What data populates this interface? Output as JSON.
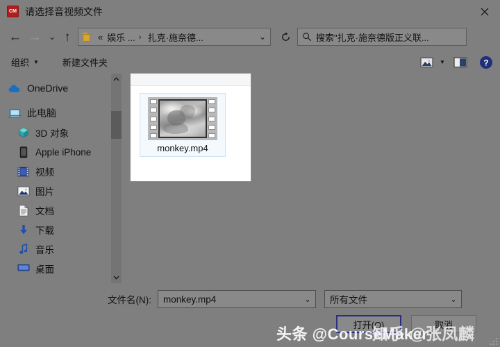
{
  "window": {
    "app_icon_text": "CM",
    "title": "请选择音视频文件",
    "close_label": "✕"
  },
  "nav": {
    "back_label": "←",
    "forward_label": "→",
    "recent_label": "⌄",
    "up_label": "↑",
    "refresh_label": "↻",
    "breadcrumb": {
      "prefix": "«",
      "parent": "娱乐 ...",
      "separator": "›",
      "current": "扎克·施奈德...",
      "chevron": "⌄"
    }
  },
  "search": {
    "icon": "search-icon",
    "placeholder": "搜索\"扎克·施奈德版正义联..."
  },
  "commandbar": {
    "organize_label": "组织",
    "organize_caret": "▼",
    "new_folder_label": "新建文件夹",
    "view_icon": "picture-view-icon",
    "view_caret": "▼",
    "preview_pane_icon": "preview-pane-icon",
    "help_icon": "help-icon",
    "help_glyph": "?"
  },
  "sidebar": {
    "items": [
      {
        "label": "OneDrive",
        "icon": "cloud-icon",
        "level": "root"
      },
      {
        "label": "此电脑",
        "icon": "this-pc-icon",
        "level": "root"
      },
      {
        "label": "3D 对象",
        "icon": "3d-objects-icon",
        "level": "child"
      },
      {
        "label": "Apple iPhone",
        "icon": "iphone-icon",
        "level": "child"
      },
      {
        "label": "视频",
        "icon": "videos-icon",
        "level": "child"
      },
      {
        "label": "图片",
        "icon": "pictures-icon",
        "level": "child"
      },
      {
        "label": "文档",
        "icon": "documents-icon",
        "level": "child"
      },
      {
        "label": "下载",
        "icon": "downloads-icon",
        "level": "child"
      },
      {
        "label": "音乐",
        "icon": "music-icon",
        "level": "child"
      },
      {
        "label": "桌面",
        "icon": "desktop-icon",
        "level": "child"
      }
    ],
    "scrollbar": {
      "up_arrow": "⌃",
      "down_arrow": "⌄"
    }
  },
  "filelist": {
    "files": [
      {
        "name": "monkey.mp4",
        "icon": "video-filmstrip-thumbnail",
        "selected": true
      }
    ]
  },
  "footer": {
    "filename_label": "文件名(N):",
    "filename_value": "monkey.mp4",
    "filename_chevron": "⌄",
    "filter_value": "所有文件",
    "filter_chevron": "⌄",
    "open_button": "打开(O)",
    "cancel_button": "取消"
  },
  "watermarks": {
    "toutiao": "头条 @CourseMaker",
    "zhihu": "知乎 @张凤麟"
  }
}
